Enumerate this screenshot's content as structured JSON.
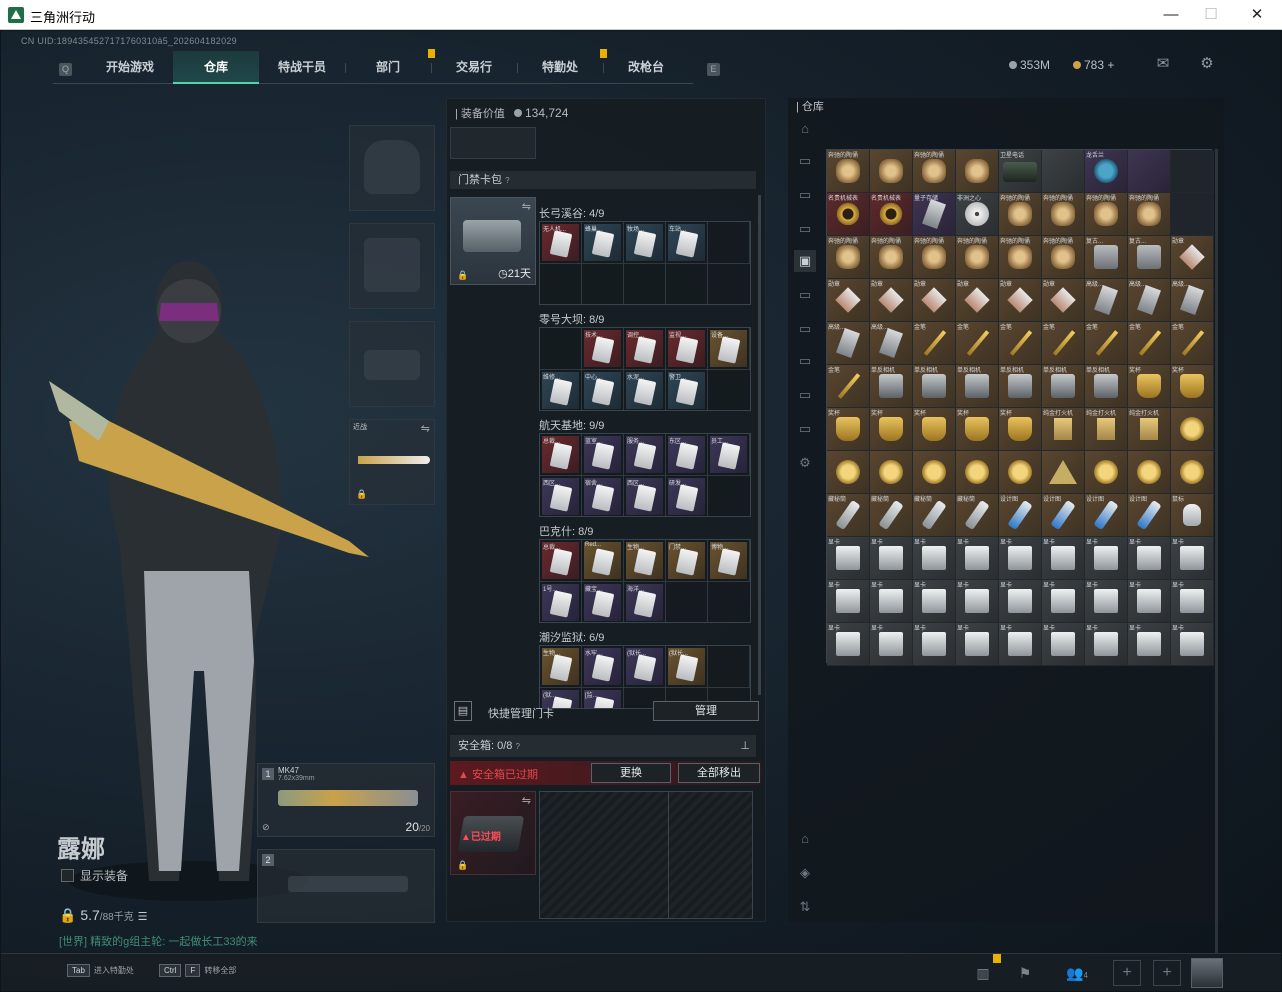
{
  "window": {
    "title": "三角洲行动",
    "minimize": "—",
    "maximize": "☐",
    "close": "✕"
  },
  "uid": "CN UID:1894354527171760310â5_202604182029",
  "nav": {
    "tabs": [
      "开始游戏",
      "仓库",
      "特战干员",
      "部门",
      "交易行",
      "特勤处",
      "改枪台"
    ],
    "active": 1,
    "left_key": "Q",
    "right_key": "E"
  },
  "currency": {
    "coins": "353M",
    "tickets": "783",
    "plus": "+"
  },
  "character": {
    "name": "露娜",
    "show_equip": "显示装备",
    "weight": "5.7",
    "weight_unit": "/88千克",
    "chat": "[世界] 精致的g组主轮: 一起做长工33的来"
  },
  "melee": {
    "label": "近战"
  },
  "guns": [
    {
      "slot": "1",
      "name": "MK47",
      "caliber": "7.62x39mm",
      "ammo": "20",
      "max": "/20"
    },
    {
      "slot": "2",
      "name": "",
      "caliber": "",
      "ammo": "",
      "max": ""
    }
  ],
  "mid": {
    "equip_value_label": "装备价值",
    "equip_value": "134,724",
    "keycard_label": "门禁卡包",
    "keycard_help": "?",
    "days": "21天",
    "areas": [
      {
        "name": "长弓溪谷: 4/9",
        "cards": [
          {
            "c": "red",
            "l": "无人机..."
          },
          {
            "c": "blue",
            "l": "蜂巢..."
          },
          {
            "c": "blue",
            "l": "牧场..."
          },
          {
            "c": "blue",
            "l": "车站..."
          },
          {
            "c": "em",
            "l": ""
          },
          {
            "c": "em",
            "l": ""
          },
          {
            "c": "em",
            "l": ""
          },
          {
            "c": "em",
            "l": ""
          },
          {
            "c": "em",
            "l": ""
          }
        ]
      },
      {
        "name": "零号大坝: 8/9",
        "cards": [
          {
            "c": "em",
            "l": ""
          },
          {
            "c": "red",
            "l": "技术..."
          },
          {
            "c": "red",
            "l": "调控..."
          },
          {
            "c": "red",
            "l": "监视..."
          },
          {
            "c": "gold",
            "l": "设备..."
          },
          {
            "c": "blue",
            "l": "维修..."
          },
          {
            "c": "blue",
            "l": "中心..."
          },
          {
            "c": "blue",
            "l": "水泥..."
          },
          {
            "c": "blue",
            "l": "警卫..."
          }
        ]
      },
      {
        "name": "航天基地: 9/9",
        "cards": [
          {
            "c": "red",
            "l": "总裁..."
          },
          {
            "c": "purple",
            "l": "蓝室..."
          },
          {
            "c": "purple",
            "l": "服务..."
          },
          {
            "c": "purple",
            "l": "东区..."
          },
          {
            "c": "purple",
            "l": "员工..."
          },
          {
            "c": "purple",
            "l": "西区..."
          },
          {
            "c": "purple",
            "l": "宿舍..."
          },
          {
            "c": "purple",
            "l": "西区..."
          },
          {
            "c": "purple",
            "l": "研发..."
          }
        ]
      },
      {
        "name": "巴克什: 8/9",
        "cards": [
          {
            "c": "red",
            "l": "总裁..."
          },
          {
            "c": "gold",
            "l": "Red..."
          },
          {
            "c": "gold",
            "l": "生物..."
          },
          {
            "c": "gold",
            "l": "门禁..."
          },
          {
            "c": "gold",
            "l": "博物..."
          },
          {
            "c": "purple",
            "l": "1号..."
          },
          {
            "c": "purple",
            "l": "藏宝..."
          },
          {
            "c": "purple",
            "l": "海洋..."
          },
          {
            "c": "em",
            "l": ""
          }
        ]
      },
      {
        "name": "潮汐监狱: 6/9",
        "cards": [
          {
            "c": "gold",
            "l": "生物..."
          },
          {
            "c": "purple",
            "l": "水牢..."
          },
          {
            "c": "purple",
            "l": "(狱长..."
          },
          {
            "c": "gold",
            "l": "(狱长..."
          },
          {
            "c": "em",
            "l": ""
          },
          {
            "c": "purple",
            "l": "(狱..."
          },
          {
            "c": "purple",
            "l": "[监..."
          },
          {
            "c": "em",
            "l": ""
          },
          {
            "c": "em",
            "l": ""
          }
        ]
      }
    ],
    "quick_manage": "快捷管理门卡",
    "manage_btn": "管理",
    "safe_label": "安全箱:",
    "safe_count": "0/8",
    "safe_help": "?",
    "safe_expired": "安全箱已过期",
    "replace_btn": "更换",
    "move_all_btn": "全部移出",
    "expired_badge": "已过期"
  },
  "right": {
    "title": "仓库"
  },
  "stash": [
    [
      {
        "c": "gd",
        "i": "relic",
        "l": "奔驰的陶俑"
      },
      {
        "c": "gd",
        "i": "relic",
        "l": ""
      },
      {
        "c": "gd",
        "i": "relic",
        "l": "奔驰的陶俑"
      },
      {
        "c": "gd",
        "i": "relic",
        "l": ""
      },
      {
        "c": "gy",
        "i": "phone",
        "l": "卫星电话"
      },
      {
        "c": "gy",
        "i": "",
        "l": ""
      },
      {
        "c": "pu",
        "i": "bottle",
        "l": "龙舌兰"
      },
      {
        "c": "pu",
        "i": "",
        "l": ""
      },
      {
        "c": "em",
        "i": "",
        "l": ""
      }
    ],
    [
      {
        "c": "rd",
        "i": "ring",
        "l": "名贵机械表"
      },
      {
        "c": "rd",
        "i": "ring",
        "l": "名贵机械表"
      },
      {
        "c": "pu",
        "i": "tag",
        "l": "量子存储"
      },
      {
        "c": "gy",
        "i": "disc",
        "l": "非洲之心"
      },
      {
        "c": "gd",
        "i": "relic",
        "l": "奔驰的陶俑"
      },
      {
        "c": "gd",
        "i": "relic",
        "l": "奔驰的陶俑"
      },
      {
        "c": "gd",
        "i": "relic",
        "l": "奔驰的陶俑"
      },
      {
        "c": "gd",
        "i": "relic",
        "l": "奔驰的陶俑"
      },
      {
        "c": "em",
        "i": "",
        "l": ""
      }
    ],
    [
      {
        "c": "gd",
        "i": "relic",
        "l": "奔驰的陶俑"
      },
      {
        "c": "gd",
        "i": "relic",
        "l": "奔驰的陶俑"
      },
      {
        "c": "gd",
        "i": "relic",
        "l": "奔驰的陶俑"
      },
      {
        "c": "gd",
        "i": "relic",
        "l": "奔驰的陶俑"
      },
      {
        "c": "gd",
        "i": "relic",
        "l": "奔驰的陶俑"
      },
      {
        "c": "gd",
        "i": "relic",
        "l": "奔驰的陶俑"
      },
      {
        "c": "gd",
        "i": "box",
        "l": "复古..."
      },
      {
        "c": "gd",
        "i": "box",
        "l": "复古..."
      },
      {
        "c": "gd",
        "i": "badge",
        "l": "勋章"
      }
    ],
    [
      {
        "c": "gd",
        "i": "badge",
        "l": "勋章"
      },
      {
        "c": "gd",
        "i": "badge",
        "l": "勋章"
      },
      {
        "c": "gd",
        "i": "badge",
        "l": "勋章"
      },
      {
        "c": "gd",
        "i": "badge",
        "l": "勋章"
      },
      {
        "c": "gd",
        "i": "badge",
        "l": "勋章"
      },
      {
        "c": "gd",
        "i": "badge",
        "l": "勋章"
      },
      {
        "c": "gd",
        "i": "tag",
        "l": "高级..."
      },
      {
        "c": "gd",
        "i": "tag",
        "l": "高级..."
      },
      {
        "c": "gd",
        "i": "tag",
        "l": "高级..."
      }
    ],
    [
      {
        "c": "gd",
        "i": "tag",
        "l": "高级..."
      },
      {
        "c": "gd",
        "i": "tag",
        "l": "高级..."
      },
      {
        "c": "gd",
        "i": "pen",
        "l": "金笔"
      },
      {
        "c": "gd",
        "i": "pen",
        "l": "金笔"
      },
      {
        "c": "gd",
        "i": "pen",
        "l": "金笔"
      },
      {
        "c": "gd",
        "i": "pen",
        "l": "金笔"
      },
      {
        "c": "gd",
        "i": "pen",
        "l": "金笔"
      },
      {
        "c": "gd",
        "i": "pen",
        "l": "金笔"
      },
      {
        "c": "gd",
        "i": "pen",
        "l": "金笔"
      }
    ],
    [
      {
        "c": "gd",
        "i": "pen",
        "l": "金笔"
      },
      {
        "c": "gd",
        "i": "camera",
        "l": "单反相机"
      },
      {
        "c": "gd",
        "i": "camera",
        "l": "单反相机"
      },
      {
        "c": "gd",
        "i": "camera",
        "l": "单反相机"
      },
      {
        "c": "gd",
        "i": "camera",
        "l": "单反相机"
      },
      {
        "c": "gd",
        "i": "camera",
        "l": "单反相机"
      },
      {
        "c": "gd",
        "i": "camera",
        "l": "单反相机"
      },
      {
        "c": "gd",
        "i": "cup",
        "l": "奖杯"
      },
      {
        "c": "gd",
        "i": "cup",
        "l": "奖杯"
      }
    ],
    [
      {
        "c": "gd",
        "i": "cup",
        "l": "奖杯"
      },
      {
        "c": "gd",
        "i": "cup",
        "l": "奖杯"
      },
      {
        "c": "gd",
        "i": "cup",
        "l": "奖杯"
      },
      {
        "c": "gd",
        "i": "cup",
        "l": "奖杯"
      },
      {
        "c": "gd",
        "i": "cup",
        "l": "奖杯"
      },
      {
        "c": "gd",
        "i": "lighter",
        "l": "纯金打火机"
      },
      {
        "c": "gd",
        "i": "lighter",
        "l": "纯金打火机"
      },
      {
        "c": "gd",
        "i": "lighter",
        "l": "纯金打火机"
      },
      {
        "c": "gd",
        "i": "coin",
        "l": ""
      }
    ],
    [
      {
        "c": "gd",
        "i": "coin",
        "l": ""
      },
      {
        "c": "gd",
        "i": "coin",
        "l": ""
      },
      {
        "c": "gd",
        "i": "coin",
        "l": ""
      },
      {
        "c": "gd",
        "i": "coin",
        "l": ""
      },
      {
        "c": "gd",
        "i": "coin",
        "l": ""
      },
      {
        "c": "gd",
        "i": "pyr",
        "l": ""
      },
      {
        "c": "gd",
        "i": "coin",
        "l": ""
      },
      {
        "c": "gd",
        "i": "coin",
        "l": ""
      },
      {
        "c": "gd",
        "i": "coin",
        "l": ""
      }
    ],
    [
      {
        "c": "gd",
        "i": "tube",
        "l": "藏秘筒"
      },
      {
        "c": "gd",
        "i": "tube",
        "l": "藏秘筒"
      },
      {
        "c": "gd",
        "i": "tube",
        "l": "藏秘筒"
      },
      {
        "c": "gd",
        "i": "tube",
        "l": "藏秘筒"
      },
      {
        "c": "gd",
        "i": "tubeb",
        "l": "设计图"
      },
      {
        "c": "gd",
        "i": "tubeb",
        "l": "设计图"
      },
      {
        "c": "gd",
        "i": "tubeb",
        "l": "设计图"
      },
      {
        "c": "gd",
        "i": "tubeb",
        "l": "设计图"
      },
      {
        "c": "gd",
        "i": "mouse",
        "l": "鼠标"
      }
    ],
    [
      {
        "c": "gy",
        "i": "dev",
        "l": "显卡"
      },
      {
        "c": "gy",
        "i": "dev",
        "l": "显卡"
      },
      {
        "c": "gy",
        "i": "dev",
        "l": "显卡"
      },
      {
        "c": "gy",
        "i": "dev",
        "l": "显卡"
      },
      {
        "c": "gy",
        "i": "dev",
        "l": "显卡"
      },
      {
        "c": "gy",
        "i": "dev",
        "l": "显卡"
      },
      {
        "c": "gy",
        "i": "dev",
        "l": "显卡"
      },
      {
        "c": "gy",
        "i": "dev",
        "l": "显卡"
      },
      {
        "c": "gy",
        "i": "dev",
        "l": "显卡"
      }
    ],
    [
      {
        "c": "gy",
        "i": "dev",
        "l": "显卡"
      },
      {
        "c": "gy",
        "i": "dev",
        "l": "显卡"
      },
      {
        "c": "gy",
        "i": "dev",
        "l": "显卡"
      },
      {
        "c": "gy",
        "i": "dev",
        "l": "显卡"
      },
      {
        "c": "gy",
        "i": "dev",
        "l": "显卡"
      },
      {
        "c": "gy",
        "i": "dev",
        "l": "显卡"
      },
      {
        "c": "gy",
        "i": "dev",
        "l": "显卡"
      },
      {
        "c": "gy",
        "i": "dev",
        "l": "显卡"
      },
      {
        "c": "gy",
        "i": "dev",
        "l": "显卡"
      }
    ],
    [
      {
        "c": "gy",
        "i": "dev",
        "l": "显卡"
      },
      {
        "c": "gy",
        "i": "dev",
        "l": "显卡"
      },
      {
        "c": "gy",
        "i": "dev",
        "l": "显卡"
      },
      {
        "c": "gy",
        "i": "dev",
        "l": "显卡"
      },
      {
        "c": "gy",
        "i": "dev",
        "l": "显卡"
      },
      {
        "c": "gy",
        "i": "dev",
        "l": "显卡"
      },
      {
        "c": "gy",
        "i": "dev",
        "l": "显卡"
      },
      {
        "c": "gy",
        "i": "dev",
        "l": "显卡"
      },
      {
        "c": "gy",
        "i": "dev",
        "l": "显卡"
      }
    ]
  ],
  "bottom": {
    "tab_key": "Tab",
    "tab_label": "进入特勤处",
    "ctrl_key": "Ctrl",
    "f_key": "F",
    "transfer_label": "转移全部",
    "squad_count": "4"
  }
}
